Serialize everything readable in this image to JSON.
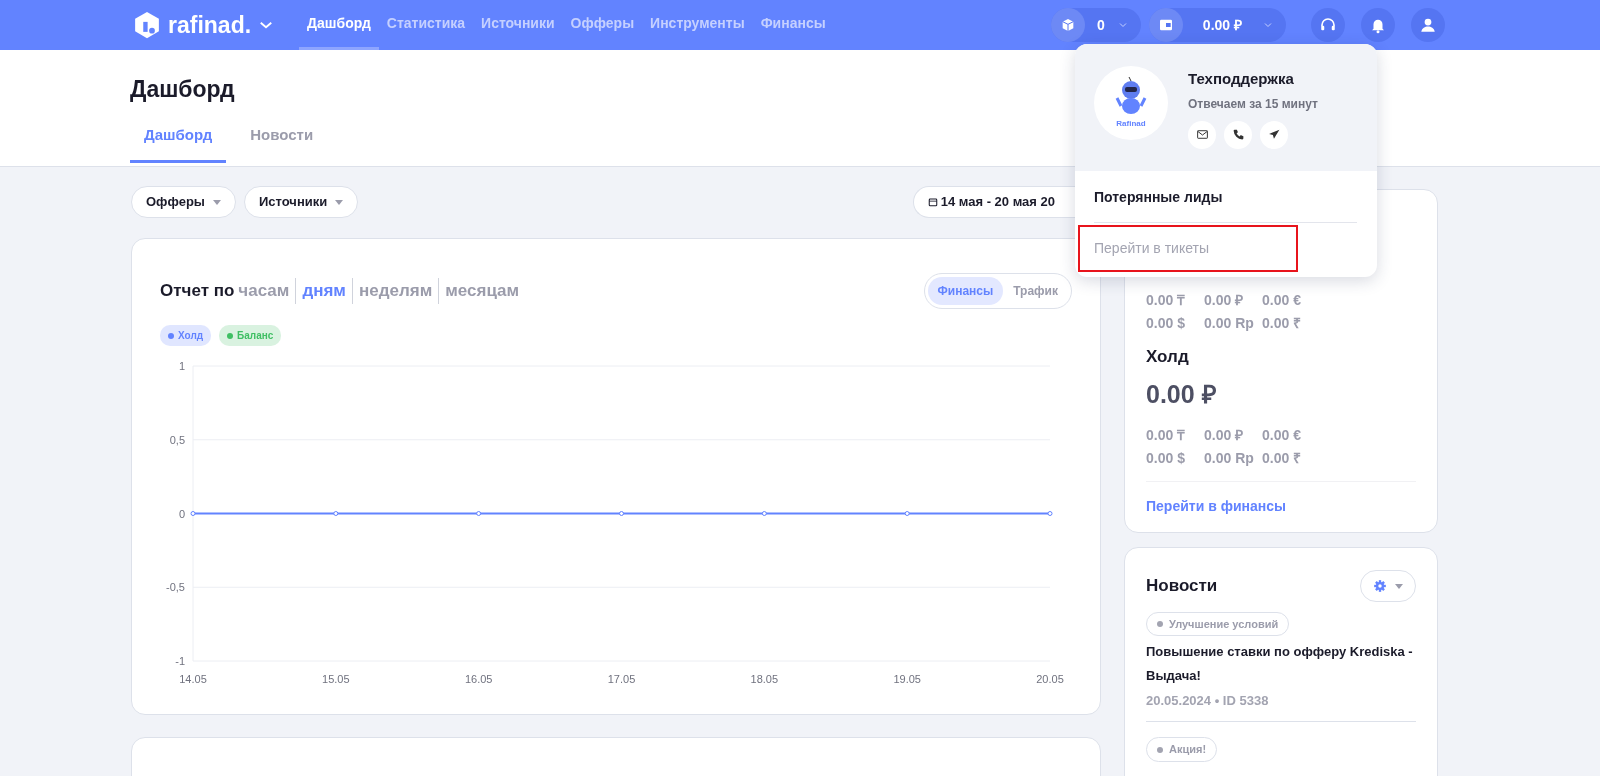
{
  "navbar": {
    "brand": "rafinad.",
    "menu": [
      {
        "label": "Дашборд",
        "selected": true
      },
      {
        "label": "Статистика",
        "selected": false
      },
      {
        "label": "Источники",
        "selected": false
      },
      {
        "label": "Офферы",
        "selected": false
      },
      {
        "label": "Инструменты",
        "selected": false
      },
      {
        "label": "Финансы",
        "selected": false
      }
    ],
    "counter": "0",
    "balance": "0.00 ₽"
  },
  "support_popup": {
    "title": "Техподдержка",
    "subtitle": "Отвечаем за 15 минут",
    "avatar_caption": "Rafinad",
    "items": [
      {
        "label": "Потерянные лиды",
        "highlighted": false,
        "muted": false
      },
      {
        "label": "Перейти в тикеты",
        "highlighted": true,
        "muted": true
      }
    ]
  },
  "page": {
    "title": "Дашборд",
    "tabs": [
      {
        "label": "Дашборд",
        "selected": true
      },
      {
        "label": "Новости",
        "selected": false
      }
    ]
  },
  "filters": [
    {
      "label": "Офферы"
    },
    {
      "label": "Источники"
    }
  ],
  "date_range": "14 мая - 20 мая 20",
  "report": {
    "title": "Отчет по",
    "periods": [
      {
        "label": "часам",
        "selected": false
      },
      {
        "label": "дням",
        "selected": true
      },
      {
        "label": "неделям",
        "selected": false
      },
      {
        "label": "месяцам",
        "selected": false
      }
    ],
    "views": [
      {
        "label": "Финансы",
        "selected": true
      },
      {
        "label": "Трафик",
        "selected": false
      }
    ],
    "chart_data": {
      "type": "line",
      "categories": [
        "14.05",
        "15.05",
        "16.05",
        "17.05",
        "18.05",
        "19.05",
        "20.05"
      ],
      "yticks": [
        {
          "value": 1,
          "label": "1"
        },
        {
          "value": 0.5,
          "label": "0,5"
        },
        {
          "value": 0,
          "label": "0"
        },
        {
          "value": -0.5,
          "label": "-0,5"
        },
        {
          "value": -1,
          "label": "-1"
        }
      ],
      "ylim": [
        -1,
        1
      ],
      "series": [
        {
          "name": "Холд",
          "color": "#6283ff",
          "marker": "circle",
          "values": [
            0,
            0,
            0,
            0,
            0,
            0,
            0
          ]
        },
        {
          "name": "Баланс",
          "color": "#3fbf63",
          "marker": "circle",
          "values": [
            null,
            null,
            null,
            null,
            null,
            null,
            null
          ]
        }
      ]
    }
  },
  "balance_card": {
    "balance_amounts": [
      "0.00 ₸",
      "0.00 ₽",
      "0.00 €",
      "0.00 $",
      "0.00 Rp",
      "0.00 ₹"
    ],
    "hold_title": "Холд",
    "hold_total": "0.00 ₽",
    "hold_amounts": [
      "0.00 ₸",
      "0.00 ₽",
      "0.00 €",
      "0.00 $",
      "0.00 Rp",
      "0.00 ₹"
    ],
    "link": "Перейти в финансы"
  },
  "news": {
    "title": "Новости",
    "items": [
      {
        "tag": "Улучшение условий",
        "title": "Повышение ставки по офферу Krediska - Выдача!",
        "meta": "20.05.2024 • ID 5338"
      },
      {
        "tag": "Акция!"
      }
    ]
  }
}
